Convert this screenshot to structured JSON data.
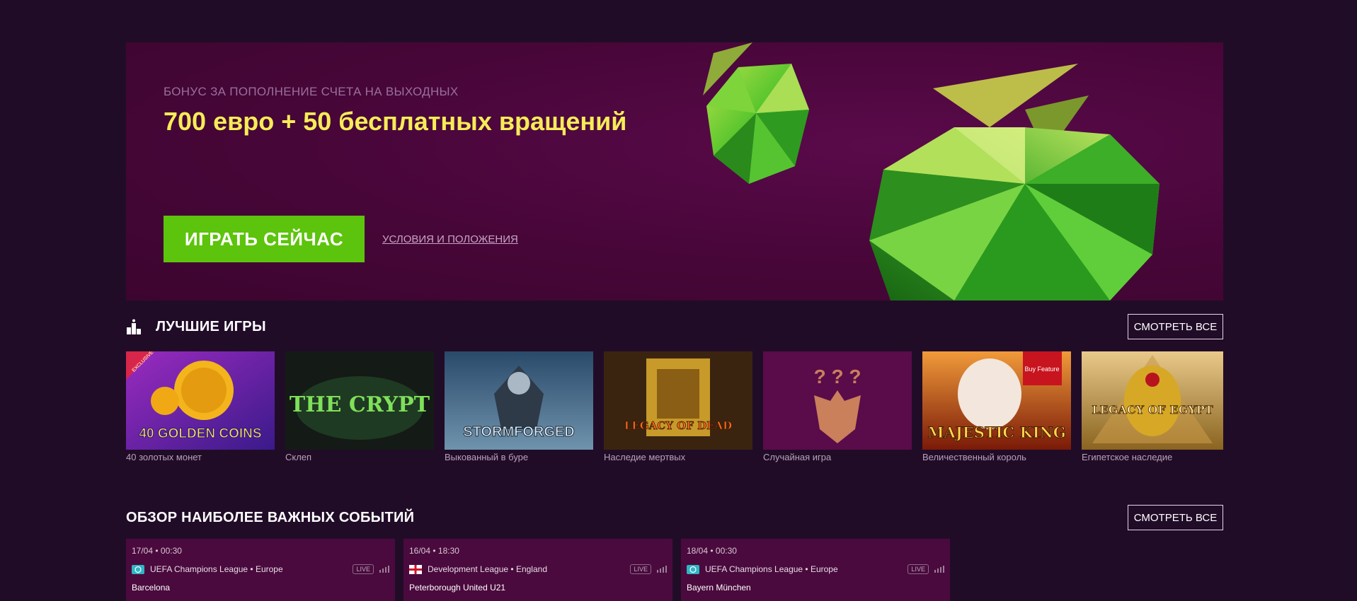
{
  "hero": {
    "eyebrow": "БОНУС ЗА ПОПОЛНЕНИЕ СЧЕТА НА ВЫХОДНЫХ",
    "title": "700 евро + 50 бесплатных вращений",
    "cta_label": "ИГРАТЬ СЕЙЧАС",
    "terms_label": "УСЛОВИЯ И ПОЛОЖЕНИЯ",
    "colors": {
      "cta": "#5cc40c",
      "title": "#f6ec57",
      "background": "#470638"
    }
  },
  "top_games": {
    "icon": "podium-icon",
    "title": "ЛУЧШИЕ ИГРЫ",
    "see_all_label": "СМОТРЕТЬ ВСЕ",
    "games": [
      {
        "name": "40 золотых монет",
        "art_text": "40 GOLDEN COINS",
        "badge": "EXCLUSIVE"
      },
      {
        "name": "Склеп",
        "art_text": "THE CRYPT"
      },
      {
        "name": "Выкованный в буре",
        "art_text": "STORMFORGED"
      },
      {
        "name": "Наследие мертвых",
        "art_text": "LEGACY OF DEAD"
      },
      {
        "name": "Случайная игра",
        "art_text": "? ? ?"
      },
      {
        "name": "Величественный король",
        "art_text": "MAJESTIC KING",
        "badge": "Buy Feature"
      },
      {
        "name": "Египетское наследие",
        "art_text": "LEGACY OF EGYPT"
      }
    ]
  },
  "events": {
    "title": "ОБЗОР НАИБОЛЕЕ ВАЖНЫХ СОБЫТИЙ",
    "see_all_label": "СМОТРЕТЬ ВСЕ",
    "live_label": "LIVE",
    "items": [
      {
        "date": "17/04 • 00:30",
        "league": "UEFA Champions League • Europe",
        "team": "Barcelona",
        "flag": "globe-icon"
      },
      {
        "date": "16/04 • 18:30",
        "league": "Development League • England",
        "team": "Peterborough United U21",
        "flag": "england-flag-icon"
      },
      {
        "date": "18/04 • 00:30",
        "league": "UEFA Champions League • Europe",
        "team": "Bayern München",
        "flag": "globe-icon"
      }
    ]
  }
}
